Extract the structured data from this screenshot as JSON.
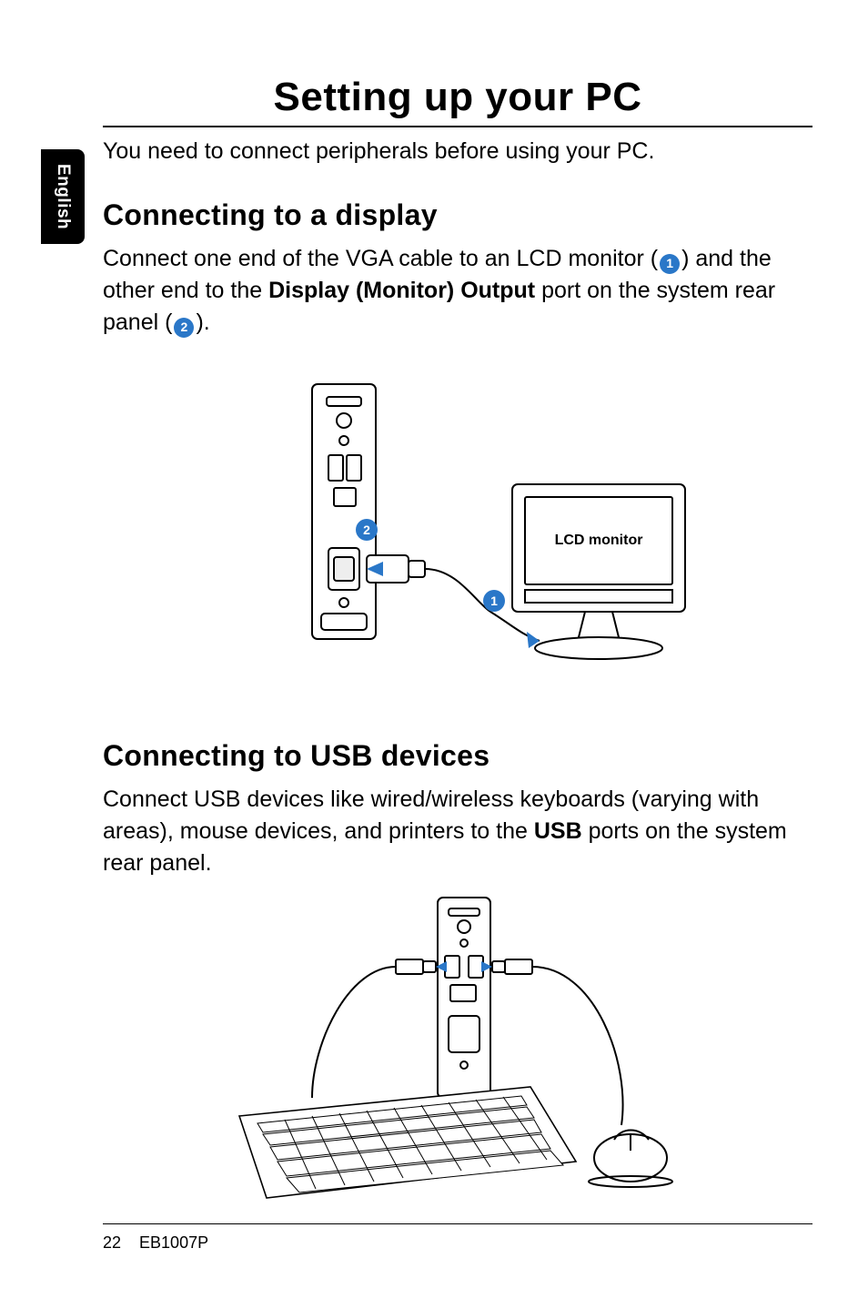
{
  "sideTab": "English",
  "title": "Setting up your PC",
  "intro": "You need to connect peripherals before using your PC.",
  "section1": {
    "heading": "Connecting to a display",
    "text_a": "Connect one end of the VGA cable to an LCD monitor (",
    "text_b": ") and the other end to the ",
    "bold": "Display (Monitor) Output",
    "text_c": " port on the system rear panel (",
    "text_d": ").",
    "callout1": "1",
    "callout2": "2",
    "figLabel": "LCD monitor"
  },
  "section2": {
    "heading": "Connecting to USB devices",
    "text_a": "Connect USB devices like wired/wireless keyboards (varying with areas), mouse devices, and printers to the ",
    "bold": "USB",
    "text_b": " ports on the system rear panel."
  },
  "footer": {
    "page": "22",
    "model": "EB1007P"
  }
}
